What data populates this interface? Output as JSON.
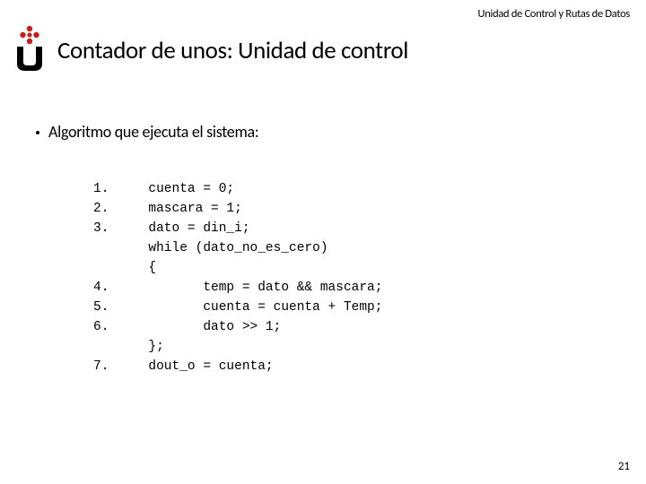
{
  "header": {
    "text": "Unidad de Control y Rutas de Datos"
  },
  "title": "Contador de unos: Unidad de control",
  "bullet": {
    "text": "Algoritmo que ejecuta el sistema:"
  },
  "code": {
    "numbers": "1.\n2.\n3.\n\n\n4.\n5.\n6.\n\n7.",
    "body": "cuenta = 0;\nmascara = 1;\ndato = din_i;\nwhile (dato_no_es_cero)\n{\n       temp = dato && mascara;\n       cuenta = cuenta + Temp;\n       dato >> 1;\n};\ndout_o = cuenta;"
  },
  "page_number": "21"
}
